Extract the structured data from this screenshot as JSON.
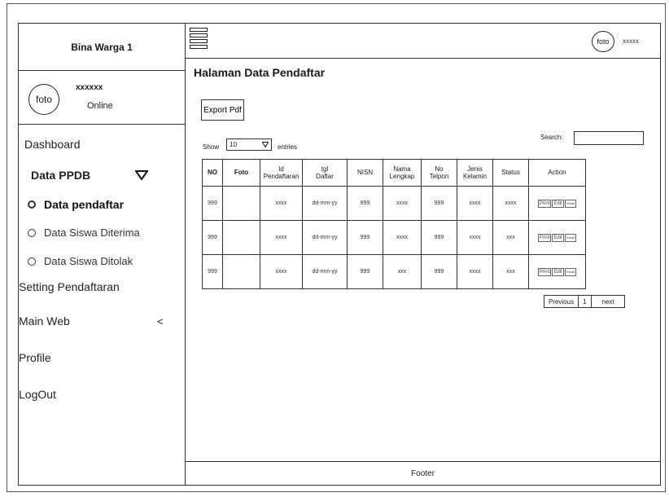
{
  "sidebar": {
    "brand": "Bina Warga 1",
    "avatar_label": "foto",
    "user_name": "xxxxxx",
    "user_status": "Online",
    "menu": {
      "dashboard": "Dashboard",
      "data_ppdb": "Data PPDB",
      "sub": {
        "data_pendaftar": "Data pendaftar",
        "data_siswa_diterima": "Data Siswa Diterima",
        "data_siswa_ditolak": "Data Siswa Ditolak"
      },
      "setting_pendaftaran": "Setting Pendaftaran",
      "main_web": "Main Web",
      "main_web_arrow": "<",
      "profile": "Profile",
      "logout": "LogOut"
    }
  },
  "topbar": {
    "avatar_label": "foto",
    "user_name": "xxxxx"
  },
  "main": {
    "title": "Halaman Data Pendaftar",
    "export_label": "Export Pdf",
    "show_label": "Show",
    "show_value": "10",
    "entries_label": "entries",
    "search_label": "Search:",
    "table": {
      "headers": {
        "no": "NO",
        "foto": "Foto",
        "id_l1": "Id",
        "id_l2": "Pendaftaran",
        "tgl_l1": "tgl",
        "tgl_l2": "Daftar",
        "nisn": "NISN",
        "nama_l1": "Nama",
        "nama_l2": "Lengkap",
        "telp_l1": "No",
        "telp_l2": "Telpon",
        "jk_l1": "Jenis",
        "jk_l2": "Kelamin",
        "status": "Status",
        "action": "Action"
      },
      "rows": [
        {
          "no": "999",
          "foto": "",
          "id": "xxxx",
          "tgl": "dd-mm-yy",
          "nisn": "999",
          "nama": "xxxx",
          "telp": "999",
          "jk": "xxxx",
          "status": "xxxx"
        },
        {
          "no": "999",
          "foto": "",
          "id": "xxxx",
          "tgl": "dd-mm-yy",
          "nisn": "999",
          "nama": "xxxx",
          "telp": "999",
          "jk": "xxxx",
          "status": "xxx"
        },
        {
          "no": "999",
          "foto": "",
          "id": "xxxx",
          "tgl": "dd-mm-yy",
          "nisn": "999",
          "nama": "xxx",
          "telp": "999",
          "jk": "xxxx",
          "status": "xxx"
        }
      ],
      "actions": {
        "print": "Print",
        "edit": "Edit",
        "detail": "Detail"
      }
    },
    "pager": {
      "previous": "Previous",
      "page": "1",
      "next": "next"
    }
  },
  "footer": {
    "label": "Footer"
  }
}
